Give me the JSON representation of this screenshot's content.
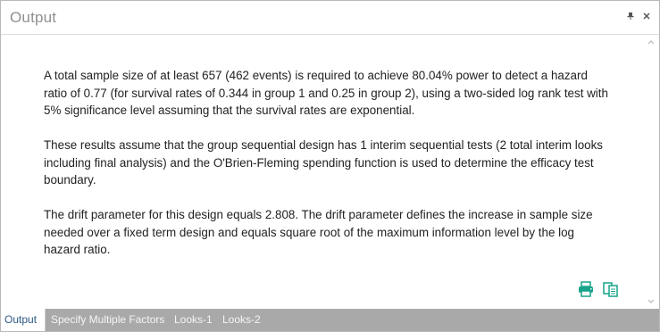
{
  "window": {
    "title": "Output"
  },
  "header": {
    "pin_icon": "pin-icon",
    "close_icon": "close-icon"
  },
  "content": {
    "paragraphs": [
      "A total sample size of at least 657 (462 events) is required to achieve 80.04% power to detect a hazard ratio of 0.77 (for survival rates of 0.344 in group 1 and 0.25 in group 2), using a two-sided log rank test with 5% significance level assuming that the survival rates are exponential.",
      "These results assume that the group sequential design has 1 interim sequential tests (2 total interim looks including final analysis) and the O'Brien-Fleming spending function is used to determine the efficacy test boundary.",
      "The drift parameter for this design equals 2.808. The drift parameter defines the increase in sample size needed over a fixed term design and equals square root of the maximum information level by the log hazard ratio."
    ]
  },
  "actions": {
    "print_icon": "printer-icon",
    "copy_icon": "copy-icon"
  },
  "tabs": [
    {
      "label": "Output",
      "active": true
    },
    {
      "label": "Specify Multiple Factors",
      "active": false
    },
    {
      "label": "Looks-1",
      "active": false
    },
    {
      "label": "Looks-2",
      "active": false
    }
  ],
  "colors": {
    "accent": "#2d5a86",
    "tabbar": "#a9a9a9",
    "icon_green": "#17a38b"
  }
}
